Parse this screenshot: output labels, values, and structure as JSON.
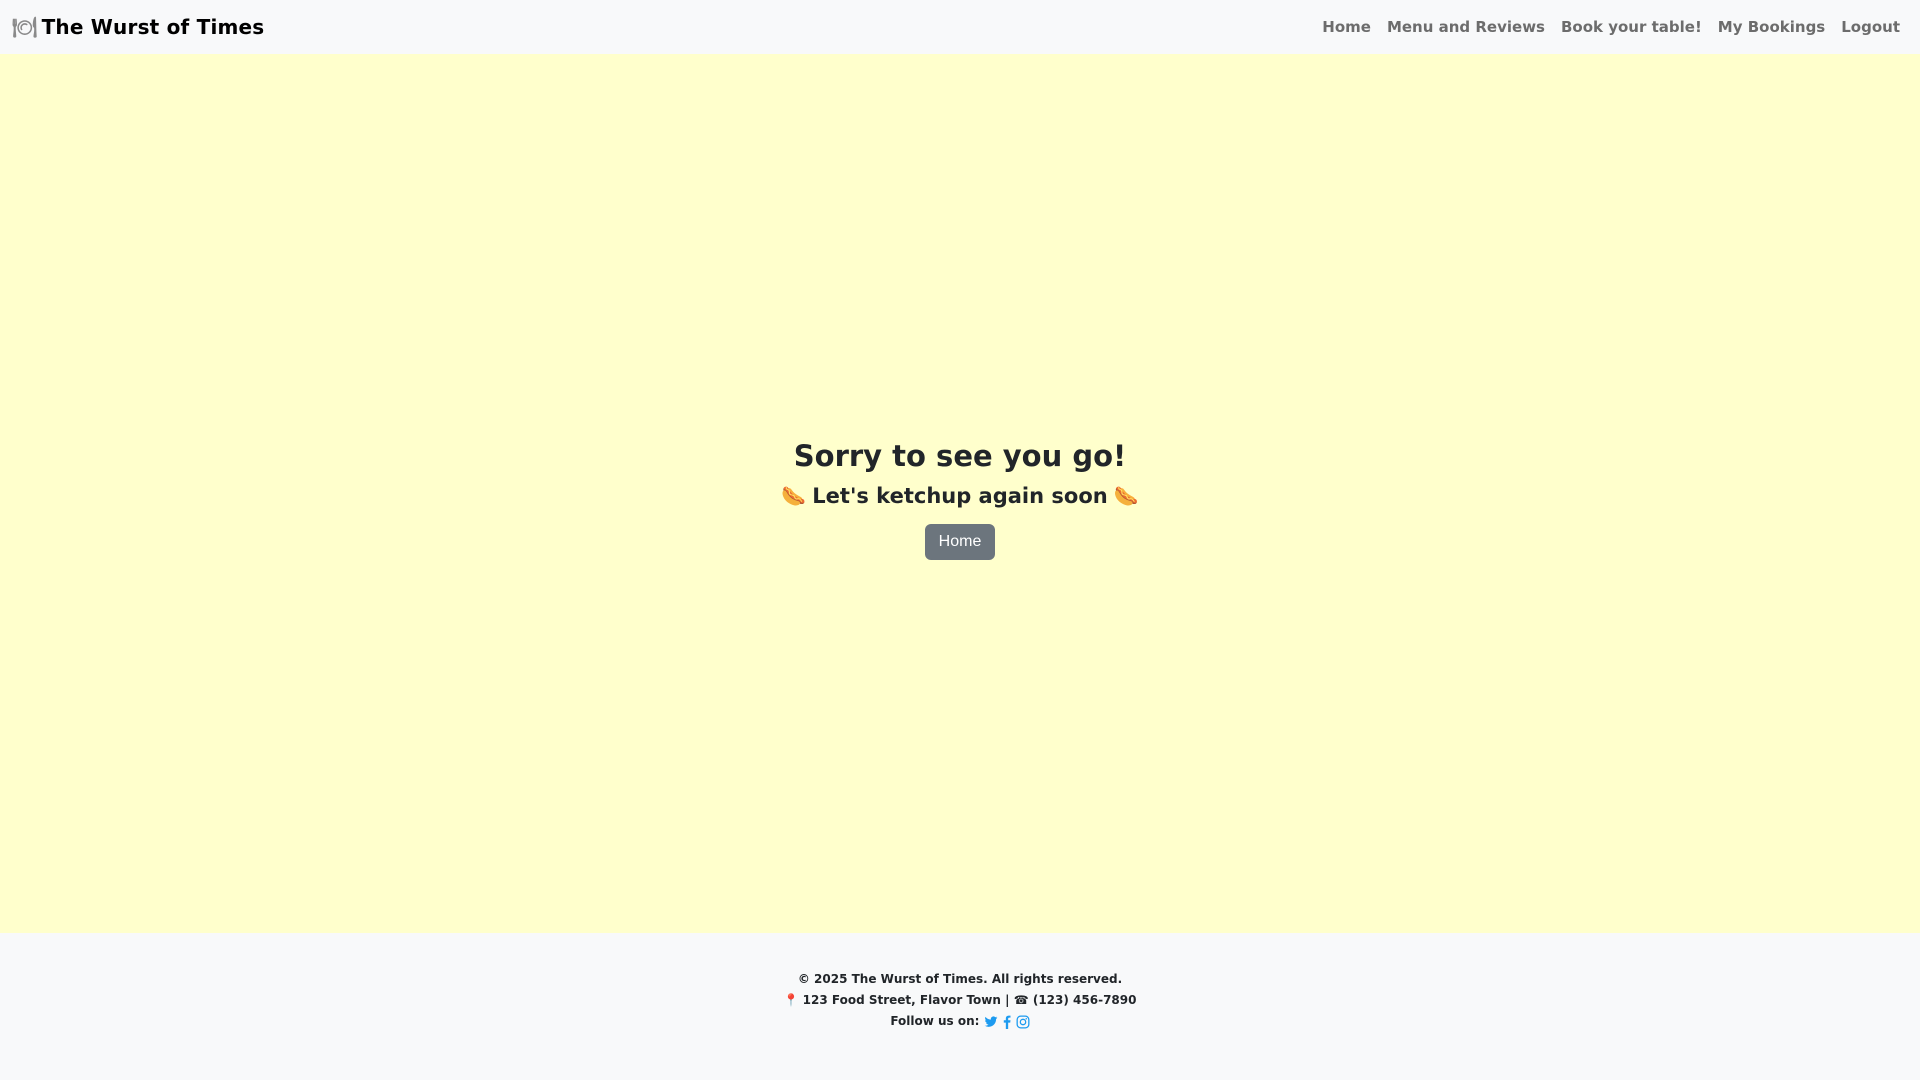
{
  "navbar": {
    "brand_icon": "plate-icon",
    "brand_title": "The Wurst of Times",
    "links": [
      "Home",
      "Menu and Reviews",
      "Book your table!",
      "My Bookings",
      "Logout"
    ]
  },
  "main": {
    "heading": "Sorry to see you go!",
    "subheading": "Let's ketchup again soon",
    "subheading_icon": "🌭",
    "home_button": "Home",
    "background": "#ffffcc"
  },
  "footer": {
    "copyright": "© 2025 The Wurst of Times. All rights reserved.",
    "address": "123 Food Street, Flavor Town",
    "separator": "|",
    "phone": "(123) 456-7890",
    "follow_label": "Follow us on:",
    "social_icons": [
      "twitter-icon",
      "facebook-icon",
      "instagram-icon"
    ],
    "social_color": "#1d9bf0"
  }
}
